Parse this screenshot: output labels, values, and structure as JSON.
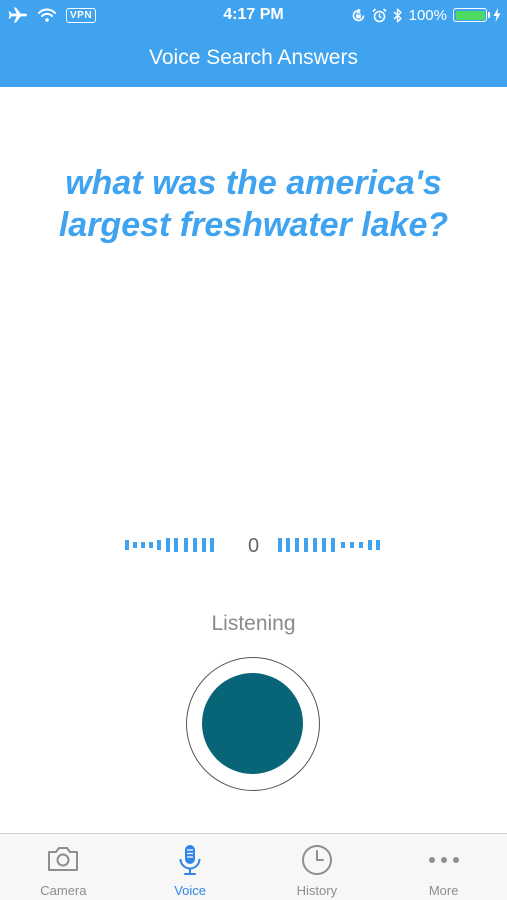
{
  "status_bar": {
    "time": "4:17 PM",
    "vpn": "VPN",
    "battery": "100%",
    "icons": [
      "airplane-icon",
      "wifi-icon",
      "rotation-lock-icon",
      "alarm-icon",
      "bluetooth-icon",
      "battery-icon",
      "charging-bolt-icon"
    ],
    "battery_level": 1.0
  },
  "header": {
    "title": "Voice Search Answers"
  },
  "main": {
    "question": "what was the america's largest freshwater lake?",
    "meter_value": "0",
    "status": "Listening"
  },
  "tabbar": {
    "tabs": [
      {
        "label": "Camera",
        "icon": "camera-icon",
        "active": false
      },
      {
        "label": "Voice",
        "icon": "microphone-icon",
        "active": true
      },
      {
        "label": "History",
        "icon": "clock-icon",
        "active": false
      },
      {
        "label": "More",
        "icon": "more-dots-icon",
        "active": false
      }
    ]
  },
  "colors": {
    "accent": "#3fa3f0",
    "record_button": "#086577",
    "tab_active": "#2f86e6",
    "tab_inactive": "#8e8e8e",
    "battery_fill": "#4cd964"
  }
}
